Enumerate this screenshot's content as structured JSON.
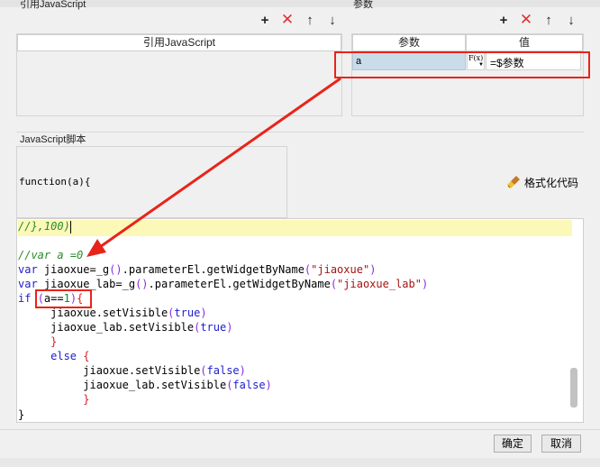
{
  "left_group": {
    "title": "引用JavaScript",
    "column_header": "引用JavaScript"
  },
  "right_group": {
    "title": "参数",
    "columns": [
      "参数",
      "值"
    ],
    "row": {
      "name": "a",
      "formula_icon": "F(x)",
      "value": "=$参数"
    }
  },
  "script_group": {
    "title": "JavaScript脚本",
    "function_signature": "function(a){"
  },
  "format_button": {
    "label": "格式化代码"
  },
  "editor": {
    "lines": [
      "//},100)",
      "",
      "//var a =0",
      "var jiaoxue=_g().parameterEl.getWidgetByName(\"jiaoxue\")",
      "var jiaoxue_lab=_g().parameterEl.getWidgetByName(\"jiaoxue_lab\")",
      "if (a==1){",
      "     jiaoxue.setVisible(true)",
      "     jiaoxue_lab.setVisible(true)",
      "     }",
      "     else {",
      "          jiaoxue.setVisible(false)",
      "          jiaoxue_lab.setVisible(false)",
      "          }"
    ],
    "closing": "}"
  },
  "footer": {
    "ok_label": "确定",
    "cancel_label": "取消"
  },
  "colors": {
    "annotation_red": "#e8241a",
    "highlight_line": "#fbf8b8",
    "selected_cell": "#c9dcea"
  }
}
